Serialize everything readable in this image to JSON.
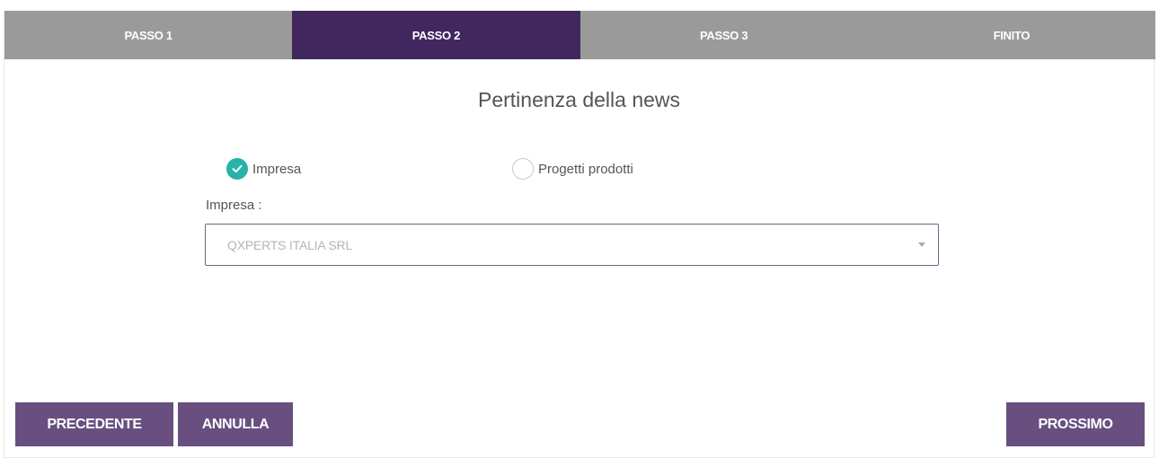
{
  "steps": [
    {
      "label": "PASSO 1",
      "active": false
    },
    {
      "label": "PASSO 2",
      "active": true
    },
    {
      "label": "PASSO 3",
      "active": false
    },
    {
      "label": "FINITO",
      "active": false
    }
  ],
  "title": "Pertinenza della news",
  "radio_options": [
    {
      "label": "Impresa",
      "checked": true
    },
    {
      "label": "Progetti prodotti",
      "checked": false
    }
  ],
  "field": {
    "label": "Impresa :",
    "selected_value": "QXPERTS ITALIA SRL"
  },
  "buttons": {
    "previous": "PRECEDENTE",
    "cancel": "ANNULLA",
    "next": "PROSSIMO"
  },
  "colors": {
    "step_active": "#41275e",
    "step_inactive": "#9a9a9a",
    "button": "#684f80",
    "check": "#27b3a7"
  }
}
